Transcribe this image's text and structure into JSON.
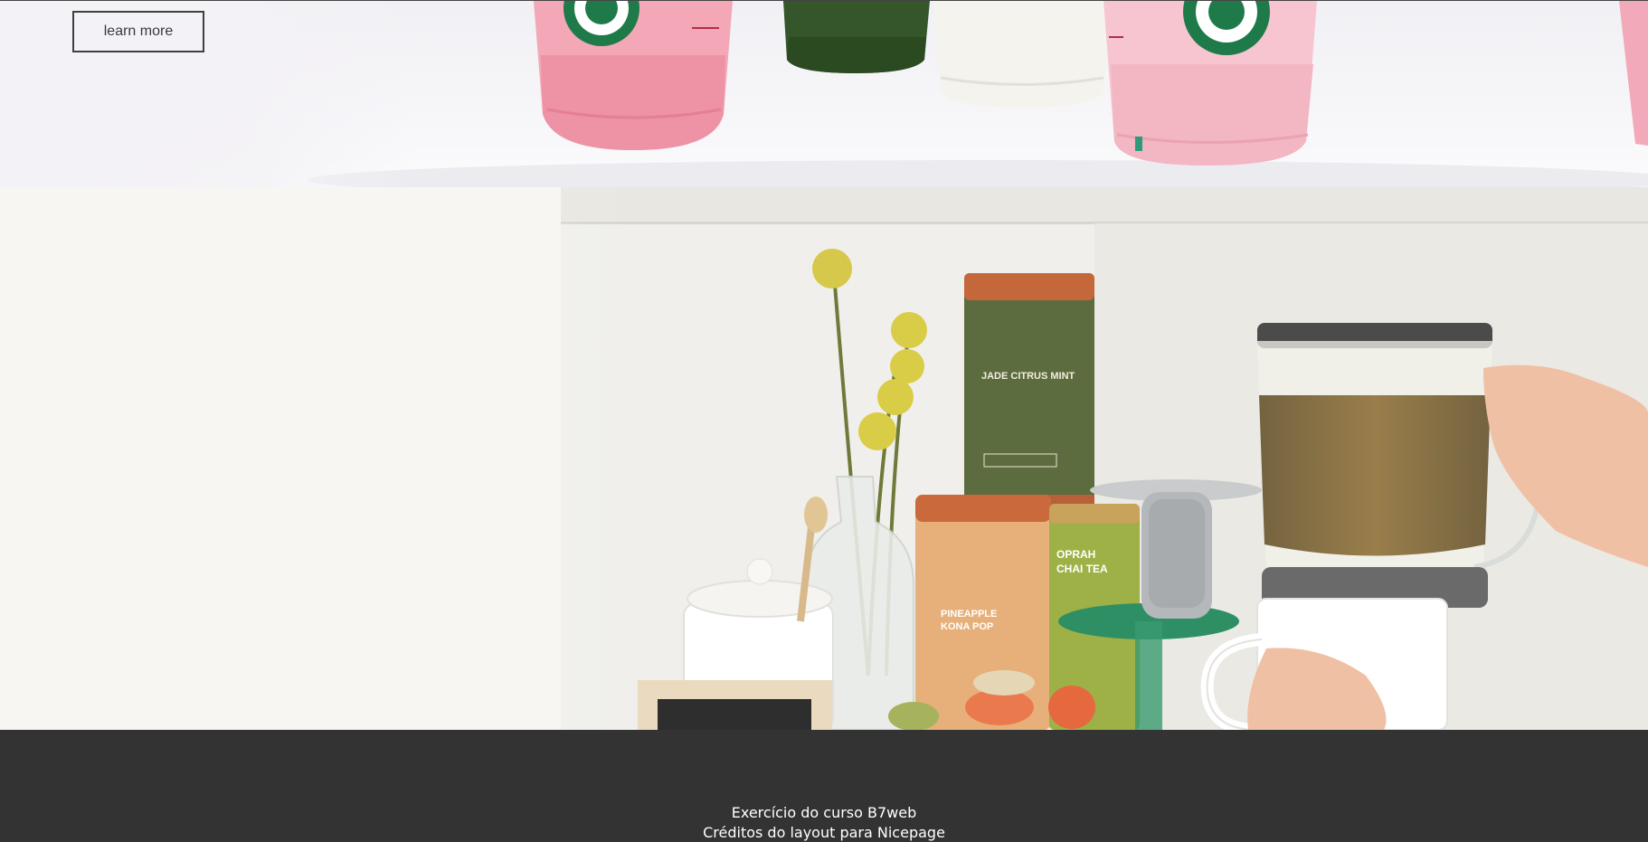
{
  "hero": {
    "button_label": "learn more",
    "image_icon": "drink-cups-photo"
  },
  "tea_section": {
    "image_icon": "tea-shelf-photo",
    "tin_labels": [
      "JADE CITRUS MINT",
      "PINEAPPLE KONA POP",
      "OPRAH CHAI TEA"
    ]
  },
  "footer": {
    "line1": "Exercício do curso B7web",
    "line2": "Créditos do layout para Nicepage"
  },
  "colors": {
    "footer_bg": "#333333",
    "footer_text": "#ffffff",
    "button_border": "#404040"
  }
}
